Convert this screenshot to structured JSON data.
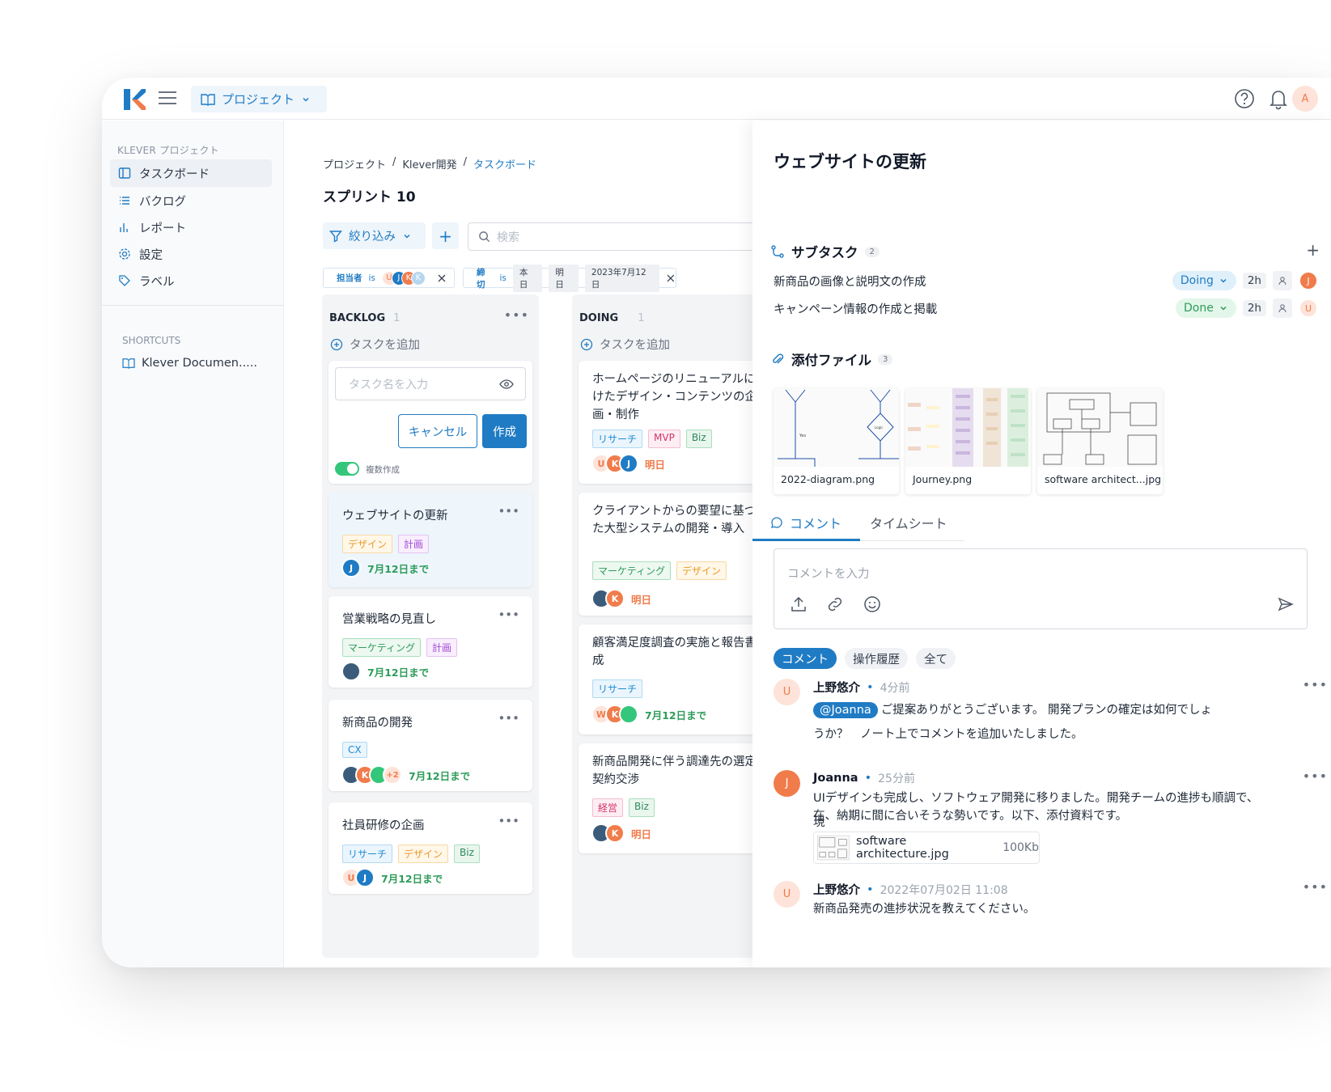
{
  "topbar": {
    "project_button": "プロジェクト",
    "user_initial": "A"
  },
  "sidebar": {
    "heading": "KLEVER プロジェクト",
    "items": [
      {
        "label": "タスクボード",
        "icon": "board-icon"
      },
      {
        "label": "バクログ",
        "icon": "list-icon"
      },
      {
        "label": "レポート",
        "icon": "chart-icon"
      },
      {
        "label": "設定",
        "icon": "gear-icon"
      },
      {
        "label": "ラベル",
        "icon": "tag-icon"
      }
    ],
    "shortcuts_heading": "SHORTCUTS",
    "shortcut_doc": "Klever Documen....."
  },
  "breadcrumb": {
    "items": [
      "プロジェクト",
      "/",
      "Klever開発",
      "/"
    ],
    "current": "タスクボード"
  },
  "sprint_title": "スプリント 10",
  "toolbar": {
    "filter_label": "絞り込み",
    "add": "+",
    "search_placeholder": "検索"
  },
  "filter_chips": {
    "assignee": {
      "key": "担当者",
      "is": "is",
      "avatars": [
        "U",
        "J",
        "K",
        "K"
      ]
    },
    "deadline": {
      "key": "締切",
      "is": "is",
      "values": [
        "本日",
        "明日",
        "2023年7月12日"
      ]
    }
  },
  "backlog": {
    "title": "BACKLOG",
    "count": "1",
    "add_task": "タスクを追加",
    "new_task_placeholder": "タスク名を入力",
    "cancel": "キャンセル",
    "create": "作成",
    "multi_create": "複数作成",
    "cards": [
      {
        "title": "ウェブサイトの更新",
        "tags": [
          "デザイン",
          "計画"
        ],
        "due": "7月12日まで"
      },
      {
        "title": "営業戦略の見直し",
        "tags": [
          "マーケティング",
          "計画"
        ],
        "due": "7月12日まで"
      },
      {
        "title": "新商品の開発",
        "tags": [
          "CX"
        ],
        "due": "7月12日まで",
        "extra": "+2"
      },
      {
        "title": "社員研修の企画",
        "tags": [
          "リサーチ",
          "デザイン",
          "Biz"
        ],
        "due": "7月12日まで"
      }
    ]
  },
  "doing": {
    "title": "DOING",
    "count": "1",
    "add_task": "タスクを追加",
    "cards": [
      {
        "title": "ホームページのリニューアルに向けたデザイン・コンテンツの企画・制作",
        "tags": [
          "リサーチ",
          "MVP",
          "Biz"
        ],
        "due": "明日"
      },
      {
        "title": "クライアントからの要望に基づいた大型システムの開発・導入",
        "tags": [
          "マーケティング",
          "デザイン"
        ],
        "due": "明日"
      },
      {
        "title": "顧客満足度調査の実施と報告書作成",
        "tags": [
          "リサーチ"
        ],
        "due": "7月12日まで"
      },
      {
        "title": "新商品開発に伴う調達先の選定と契約交渉",
        "tags": [
          "経営",
          "Biz"
        ],
        "due": "明日"
      }
    ]
  },
  "panel": {
    "title": "ウェブサイトの更新",
    "subtasks_heading": "サブタスク",
    "subtasks_count": "2",
    "subtasks": [
      {
        "title": "新商品の画像と説明文の作成",
        "status": "Doing",
        "hours": "2h",
        "avatar": "J"
      },
      {
        "title": "キャンペーン情報の作成と掲載",
        "status": "Done",
        "hours": "2h",
        "avatar": "U"
      }
    ],
    "attachments_heading": "添付ファイル",
    "attachments_count": "3",
    "attachments": [
      "2022-diagram.png",
      "Journey.png",
      "software architect...jpg"
    ],
    "tabs": [
      "コメント",
      "タイムシート"
    ],
    "comment_placeholder": "コメントを入力",
    "filters": [
      "コメント",
      "操作履歴",
      "全て"
    ],
    "comments": [
      {
        "initial": "U",
        "name": "上野悠介",
        "dot": "•",
        "time": "4分前",
        "mention": "@Joanna",
        "line1": "ご提案ありがとうございます。 開発プランの確定は如何でしょ",
        "line2": "うか？　ノート上でコメントを追加いたしました。"
      },
      {
        "initial": "J",
        "name": "Joanna",
        "dot": "•",
        "time": "25分前",
        "line1": "UIデザインも完成し、ソフトウェア開発に移りました。開発チームの進捗も順調で、現",
        "line2": "在、納期に間に合いそうな勢いです。以下、添付資料です。",
        "file": "software architecture.jpg",
        "file_size": "100Kb"
      },
      {
        "initial": "U",
        "name": "上野悠介",
        "dot": "•",
        "time": "2022年07月02日 11:08",
        "line1": "新商品発売の進捗状況を教えてください。"
      }
    ]
  },
  "colors": {
    "accent": "#1f7bc4",
    "orange": "#f07c4b",
    "green": "#2e9c5a"
  }
}
